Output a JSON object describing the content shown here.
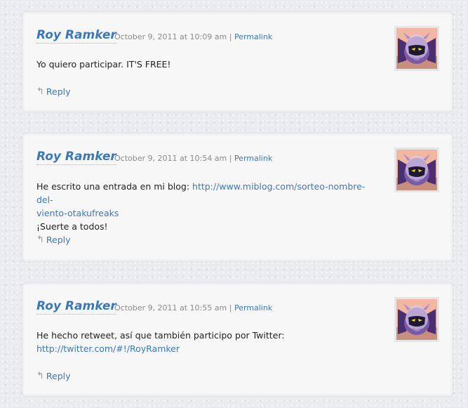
{
  "comments": [
    {
      "author": "Roy Ramker",
      "date": "October 9, 2011 at 10:09 am",
      "separator": "|",
      "permalink": "Permalink",
      "lines": [
        "Yo quiero participar. IT'S FREE!"
      ],
      "link": "",
      "reply": "Reply",
      "avatar_icon": "meta-knight-avatar-icon"
    },
    {
      "author": "Roy Ramker",
      "date": "October 9, 2011 at 10:54 am",
      "separator": "|",
      "permalink": "Permalink",
      "text_before_link": "He escrito una entrada en mi blog: ",
      "link": "http://www.miblog.com/sorteo-nombre-del-viento-otakufreaks",
      "link_line1": "http://www.miblog.com/sorteo-nombre-del-",
      "link_line2": "viento-otakufreaks",
      "after_link": "¡Suerte a todos!",
      "reply": "Reply",
      "avatar_icon": "meta-knight-avatar-icon"
    },
    {
      "author": "Roy Ramker",
      "date": "October 9, 2011 at 10:55 am",
      "separator": "|",
      "permalink": "Permalink",
      "text": "He hecho retweet, así que también participo por Twitter:",
      "link": "http://twitter.com/#!/RoyRamker",
      "reply": "Reply",
      "avatar_icon": "meta-knight-avatar-icon"
    }
  ],
  "colors": {
    "link": "#3a78b8",
    "meta": "#8a8a8a",
    "card": "#f7f7f7",
    "background": "#e9ebee"
  }
}
